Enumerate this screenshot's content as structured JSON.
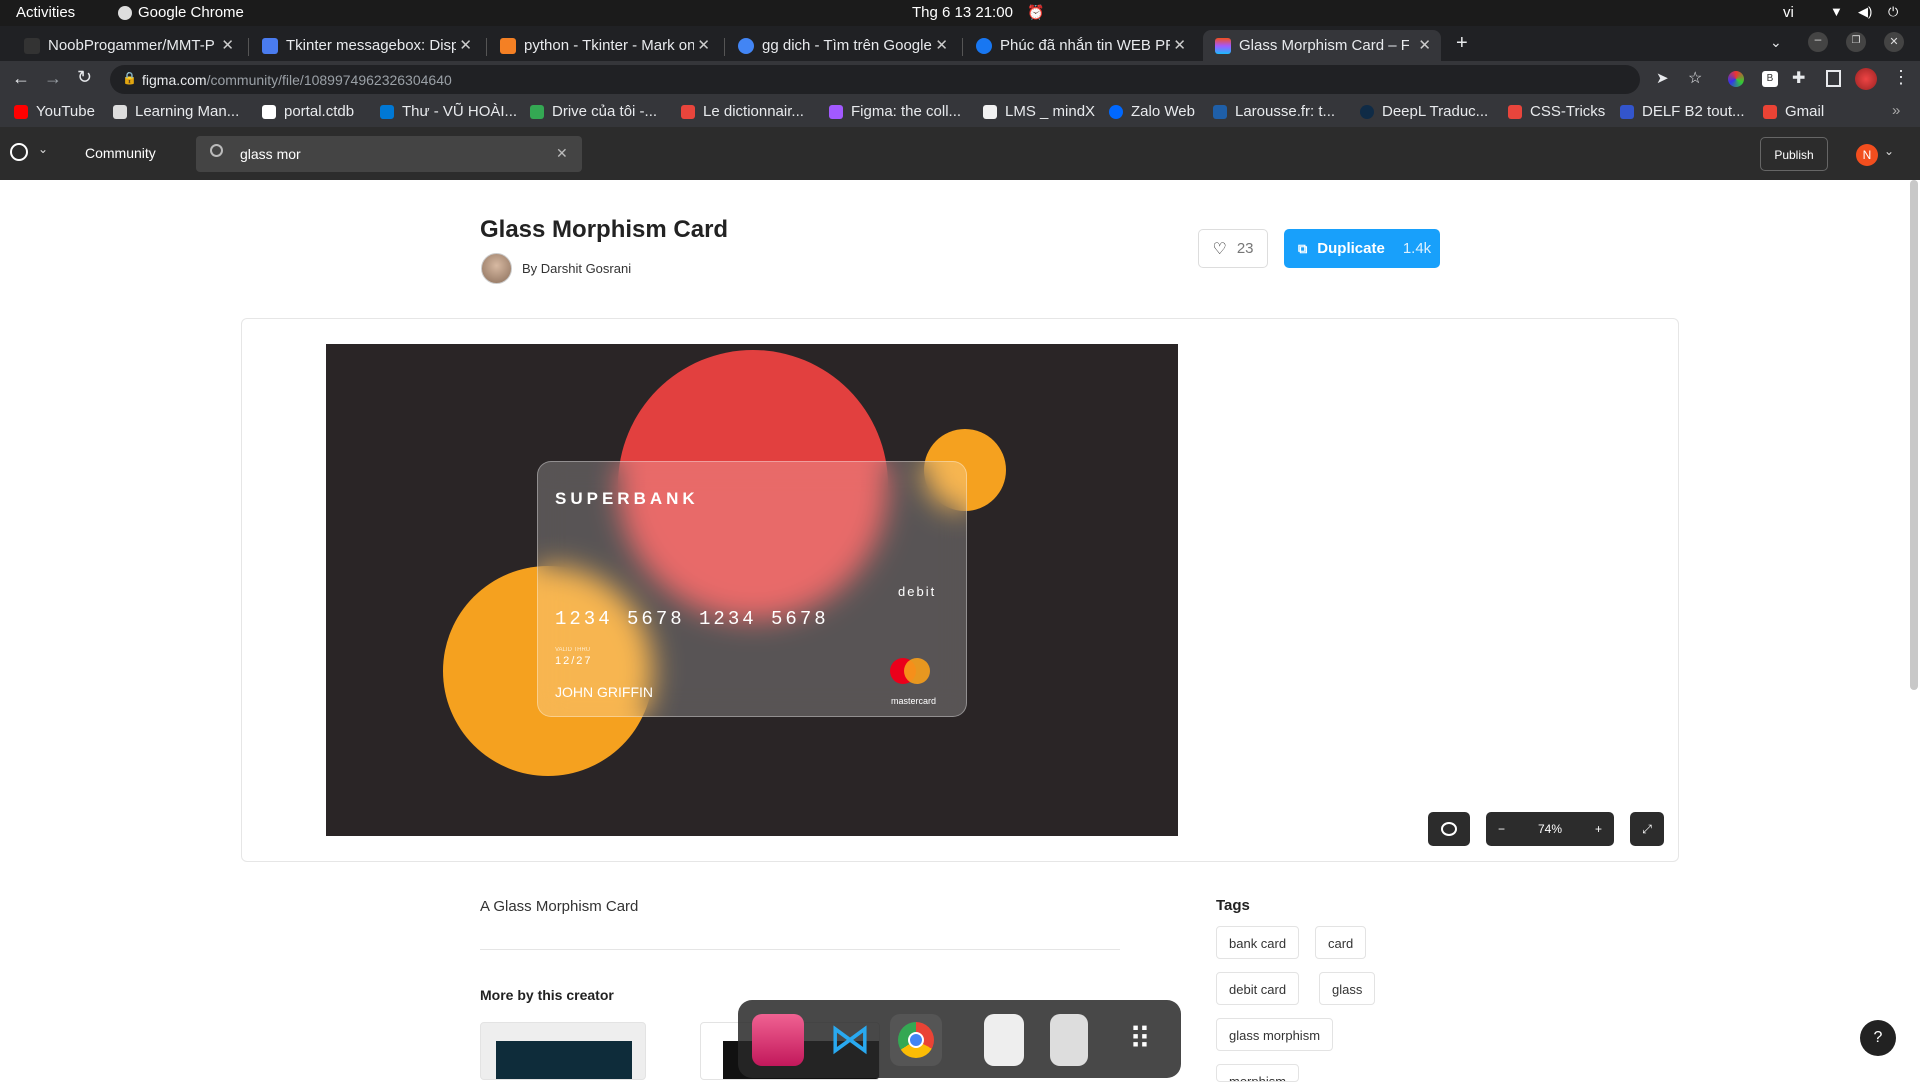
{
  "system": {
    "activities": "Activities",
    "app": "Google Chrome",
    "clock": "Thg 6 13  21:00",
    "lang": "vi"
  },
  "tabs": [
    {
      "title": "NoobProgammer/MMT-P",
      "color": "#333333"
    },
    {
      "title": "Tkinter messagebox: Disp",
      "color": "#4a7cf0"
    },
    {
      "title": "python - Tkinter - Mark on",
      "color": "#f48024"
    },
    {
      "title": "gg dich - Tìm trên Google",
      "color": "#4285f4"
    },
    {
      "title": "Phúc đã nhắn tin WEB PR",
      "color": "#1877f2"
    },
    {
      "title": "Glass Morphism Card – Fig",
      "color": "#f24e1e"
    }
  ],
  "address": {
    "domain": "figma.com",
    "path": "/community/file/1089974962326304640"
  },
  "bookmarks": [
    {
      "label": "YouTube",
      "color": "#ff0000"
    },
    {
      "label": "Learning Man...",
      "color": "#dddddd"
    },
    {
      "label": "portal.ctdb",
      "color": "#ffffff"
    },
    {
      "label": "Thư - VŨ HOÀI...",
      "color": "#0078d4"
    },
    {
      "label": "Drive của tôi -...",
      "color": "#34a853"
    },
    {
      "label": "Le dictionnair...",
      "color": "#e8453c"
    },
    {
      "label": "Figma: the coll...",
      "color": "#a259ff"
    },
    {
      "label": "LMS _ mindX",
      "color": "#f1f1f1"
    },
    {
      "label": "Zalo Web",
      "color": "#0068ff"
    },
    {
      "label": "Larousse.fr: t...",
      "color": "#1f5fa8"
    },
    {
      "label": "DeepL Traduc...",
      "color": "#0f2b46"
    },
    {
      "label": "CSS-Tricks",
      "color": "#e8453c"
    },
    {
      "label": "DELF B2 tout...",
      "color": "#3355cc"
    },
    {
      "label": "Gmail",
      "color": "#ea4335"
    }
  ],
  "figma": {
    "community": "Community",
    "search_value": "glass mor",
    "publish": "Publish",
    "user_initial": "N"
  },
  "file": {
    "title": "Glass Morphism Card",
    "author": "By Darshit Gosrani",
    "likes": "23",
    "duplicate": "Duplicate",
    "duplicate_count": "1.4k",
    "zoom": "74%",
    "description": "A Glass Morphism Card",
    "more_heading": "More by this creator",
    "tags_heading": "Tags",
    "tags": [
      "bank card",
      "card",
      "debit card",
      "glass",
      "glass morphism",
      "morphism"
    ]
  },
  "card": {
    "bank": "SUPERBANK",
    "type": "debit",
    "number": "1234 5678 1234 5678",
    "valid_label": "VALID THRU",
    "expiry": "12/27",
    "holder": "JOHN GRIFFIN",
    "brand": "mastercard"
  },
  "colors": {
    "canvas": "#2a2526",
    "red": "#e2403f",
    "orange": "#f5a11f",
    "duplicate": "#18a0fb"
  }
}
